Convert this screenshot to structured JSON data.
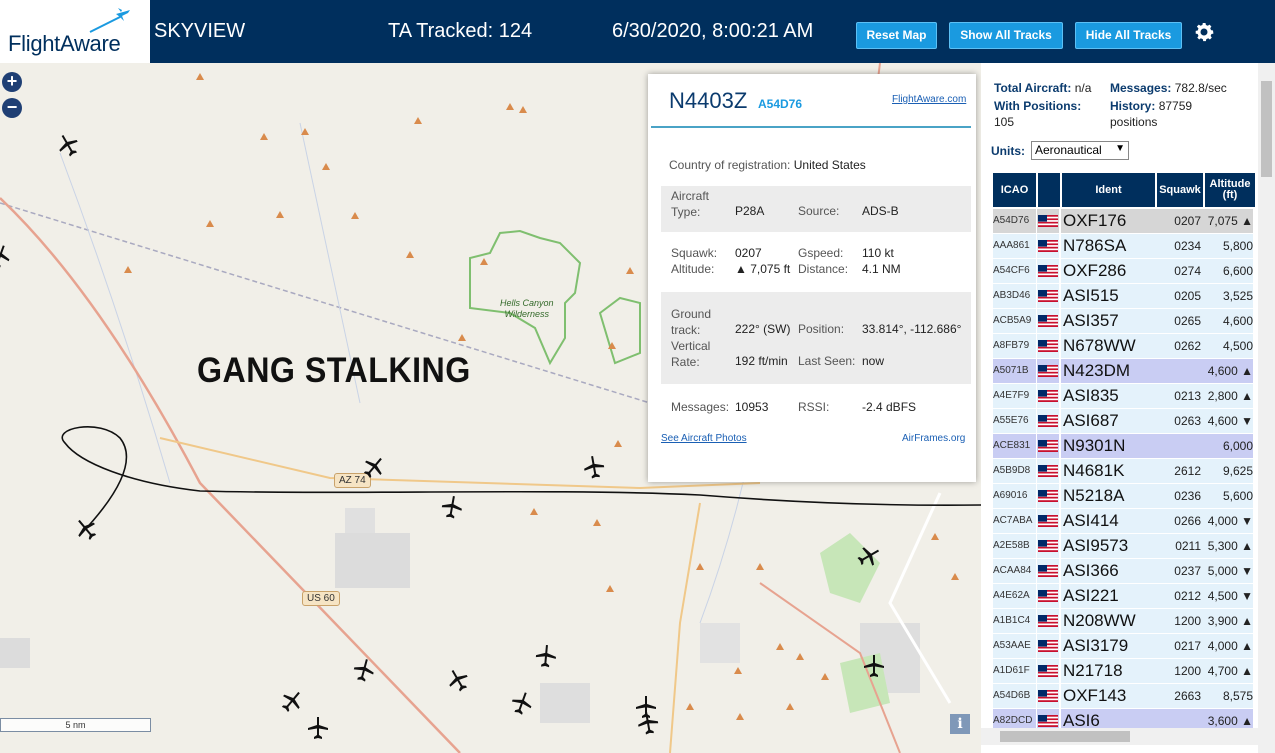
{
  "header": {
    "logo": "FlightAware",
    "title": "SKYVIEW",
    "tracked": "TA Tracked: 124",
    "datetime": "6/30/2020, 8:00:21 AM",
    "reset_label": "Reset Map",
    "show_label": "Show All Tracks",
    "hide_label": "Hide All Tracks"
  },
  "map": {
    "zoom_in": "+",
    "zoom_out": "−",
    "overlay": "GANG STALKING",
    "scale": "5 nm",
    "info": "i",
    "wilderness": "Hells Canyon\nWilderness",
    "road_az": "AZ 74",
    "road_us": "US 60"
  },
  "popup": {
    "registration": "N4403Z",
    "icao": "A54D76",
    "link": "FlightAware.com",
    "country_label": "Country of registration:",
    "country": "United States",
    "aircraft_type_label": "Aircraft Type:",
    "aircraft_type": "P28A",
    "source_label": "Source:",
    "source": "ADS-B",
    "squawk_label": "Squawk:",
    "squawk": "0207",
    "gspeed_label": "Gspeed:",
    "gspeed": "110 kt",
    "altitude_label": "Altitude:",
    "altitude": "▲ 7,075 ft",
    "distance_label": "Distance:",
    "distance": "4.1 NM",
    "track_label": "Ground track:",
    "track": "222° (SW)",
    "position_label": "Position:",
    "position": "33.814°, -112.686°",
    "vrate_label": "Vertical Rate:",
    "vrate": "192 ft/min",
    "lastseen_label": "Last Seen:",
    "lastseen": "now",
    "messages_label": "Messages:",
    "messages": "10953",
    "rssi_label": "RSSI:",
    "rssi": "-2.4 dBFS",
    "photos_link": "See Aircraft Photos",
    "airframes_link": "AirFrames.org"
  },
  "sidebar": {
    "total_label": "Total Aircraft:",
    "total": "n/a",
    "withpos_label": "With Positions:",
    "withpos": "105",
    "messages_label": "Messages:",
    "messages": "782.8/sec",
    "history_label": "History:",
    "history": "87759 positions",
    "units_label": "Units:",
    "units_value": "Aeronautical",
    "columns": [
      "ICAO",
      "",
      "Ident",
      "Squawk",
      "Altitude (ft)"
    ],
    "rows": [
      {
        "icao": "A54D76",
        "ident": "OXF176",
        "squawk": "0207",
        "alt": "7,075 ▲",
        "style": "selected"
      },
      {
        "icao": "AAA861",
        "ident": "N786SA",
        "squawk": "0234",
        "alt": "5,800",
        "style": "normal"
      },
      {
        "icao": "A54CF6",
        "ident": "OXF286",
        "squawk": "0274",
        "alt": "6,600",
        "style": "normal"
      },
      {
        "icao": "AB3D46",
        "ident": "ASI515",
        "squawk": "0205",
        "alt": "3,525",
        "style": "normal"
      },
      {
        "icao": "ACB5A9",
        "ident": "ASI357",
        "squawk": "0265",
        "alt": "4,600",
        "style": "normal"
      },
      {
        "icao": "A8FB79",
        "ident": "N678WW",
        "squawk": "0262",
        "alt": "4,500",
        "style": "normal"
      },
      {
        "icao": "A5071B",
        "ident": "N423DM",
        "squawk": "",
        "alt": "4,600 ▲",
        "style": "mlat"
      },
      {
        "icao": "A4E7F9",
        "ident": "ASI835",
        "squawk": "0213",
        "alt": "2,800 ▲",
        "style": "normal"
      },
      {
        "icao": "A55E76",
        "ident": "ASI687",
        "squawk": "0263",
        "alt": "4,600 ▼",
        "style": "normal"
      },
      {
        "icao": "ACE831",
        "ident": "N9301N",
        "squawk": "",
        "alt": "6,000",
        "style": "mlat"
      },
      {
        "icao": "A5B9D8",
        "ident": "N4681K",
        "squawk": "2612",
        "alt": "9,625",
        "style": "normal"
      },
      {
        "icao": "A69016",
        "ident": "N5218A",
        "squawk": "0236",
        "alt": "5,600",
        "style": "normal"
      },
      {
        "icao": "AC7ABA",
        "ident": "ASI414",
        "squawk": "0266",
        "alt": "4,000 ▼",
        "style": "normal"
      },
      {
        "icao": "A2E58B",
        "ident": "ASI9573",
        "squawk": "0211",
        "alt": "5,300 ▲",
        "style": "normal"
      },
      {
        "icao": "ACAA84",
        "ident": "ASI366",
        "squawk": "0237",
        "alt": "5,000 ▼",
        "style": "normal"
      },
      {
        "icao": "A4E62A",
        "ident": "ASI221",
        "squawk": "0212",
        "alt": "4,500 ▼",
        "style": "normal"
      },
      {
        "icao": "A1B1C4",
        "ident": "N208WW",
        "squawk": "1200",
        "alt": "3,900 ▲",
        "style": "normal"
      },
      {
        "icao": "A53AAE",
        "ident": "ASI3179",
        "squawk": "0217",
        "alt": "4,000 ▲",
        "style": "normal"
      },
      {
        "icao": "A1D61F",
        "ident": "N21718",
        "squawk": "1200",
        "alt": "4,700 ▲",
        "style": "normal"
      },
      {
        "icao": "A54D6B",
        "ident": "OXF143",
        "squawk": "2663",
        "alt": "8,575",
        "style": "normal"
      },
      {
        "icao": "A82DCD",
        "ident": "ASI6",
        "squawk": "",
        "alt": "3,600 ▲",
        "style": "mlat"
      }
    ]
  },
  "colors": {
    "header_bg": "#002f5d",
    "button_bg": "#1a9ae0",
    "row_normal": "#e4f2fb",
    "row_selected": "#d6d6d6",
    "row_mlat": "#c9cdf3"
  }
}
